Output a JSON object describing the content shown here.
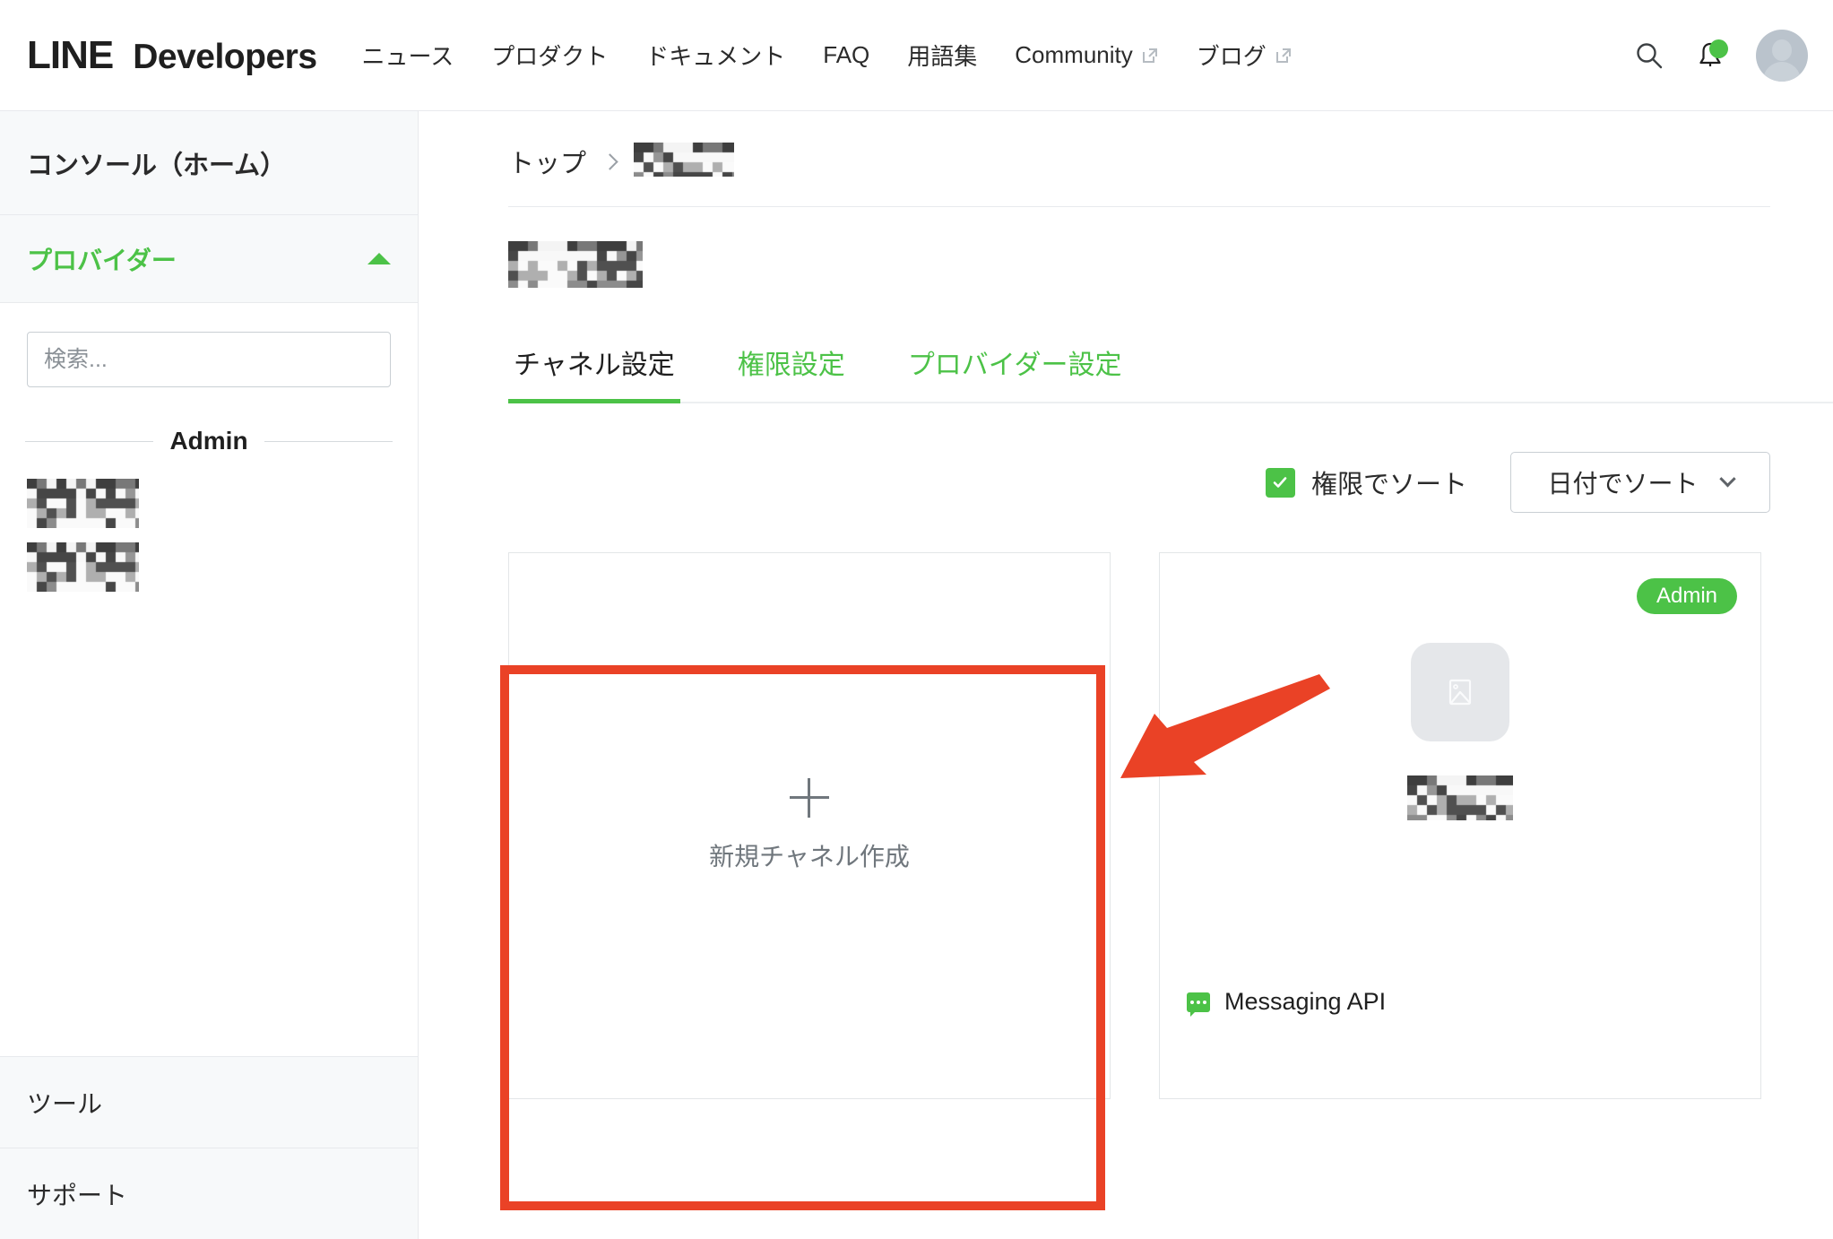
{
  "header": {
    "brand_line": "LINE",
    "brand_dev": "Developers",
    "nav": [
      {
        "label": "ニュース",
        "external": false
      },
      {
        "label": "プロダクト",
        "external": false
      },
      {
        "label": "ドキュメント",
        "external": false
      },
      {
        "label": "FAQ",
        "external": false
      },
      {
        "label": "用語集",
        "external": false
      },
      {
        "label": "Community",
        "external": true
      },
      {
        "label": "ブログ",
        "external": true
      }
    ],
    "search_icon": "search-icon",
    "notification_icon": "bell-icon",
    "notification_dot_color": "#4cc247",
    "avatar_icon": "avatar"
  },
  "sidebar": {
    "home_label": "コンソール（ホーム）",
    "provider_label": "プロバイダー",
    "provider_collapse_icon": "chevron-up-icon",
    "search_placeholder": "検索...",
    "search_value": "",
    "admin_divider_label": "Admin",
    "provider_items": [
      {
        "label": "",
        "redacted": true
      },
      {
        "label": "",
        "redacted": true
      }
    ],
    "tools_label": "ツール",
    "support_label": "サポート"
  },
  "main": {
    "breadcrumb": {
      "top_label": "トップ",
      "separator_icon": "chevron-right-icon",
      "current_label": "",
      "current_redacted": true
    },
    "page_title": "",
    "page_title_redacted": true,
    "tabs": [
      {
        "label": "チャネル設定",
        "active": true
      },
      {
        "label": "権限設定",
        "active": false
      },
      {
        "label": "プロバイダー設定",
        "active": false
      }
    ],
    "controls": {
      "sort_by_role_label": "権限でソート",
      "sort_by_role_checked": true,
      "checkbox_color": "#4cc247",
      "sort_select_value": "日付でソート",
      "sort_select_icon": "chevron-down-icon"
    },
    "cards": [
      {
        "type": "new-channel",
        "plus_icon": "plus-icon",
        "label": "新規チャネル作成"
      },
      {
        "type": "channel",
        "badge": "Admin",
        "badge_color": "#4cc247",
        "thumbnail_icon": "image-placeholder-icon",
        "name": "",
        "name_redacted": true,
        "channel_type_icon": "messaging-api-icon",
        "channel_type": "Messaging API"
      }
    ]
  },
  "annotations": {
    "highlight_box_color": "#ea4226",
    "arrow_color": "#ea4226",
    "arrow_icon": "arrow-pointer-icon"
  }
}
